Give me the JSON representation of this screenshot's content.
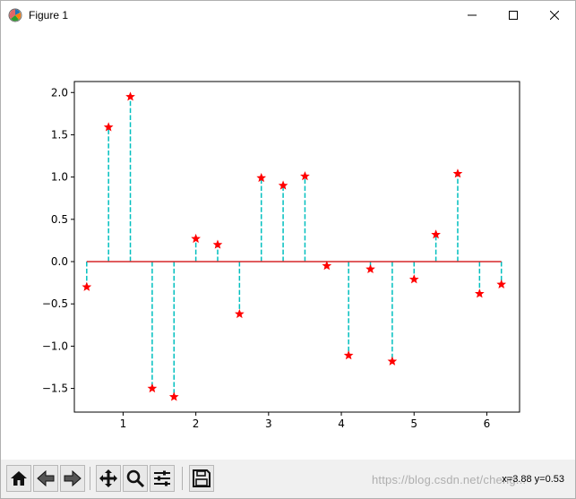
{
  "window": {
    "title": "Figure 1",
    "icons": {
      "app": "matplotlib-icon",
      "minimize": "minimize-icon",
      "maximize": "maximize-icon",
      "close": "close-icon"
    }
  },
  "toolbar": {
    "buttons": [
      {
        "name": "home-button",
        "icon": "home-icon"
      },
      {
        "name": "back-button",
        "icon": "arrow-left-icon"
      },
      {
        "name": "forward-button",
        "icon": "arrow-right-icon"
      },
      {
        "name": "pan-button",
        "icon": "move-icon"
      },
      {
        "name": "zoom-button",
        "icon": "magnifier-icon"
      },
      {
        "name": "configure-subplots-button",
        "icon": "sliders-icon"
      },
      {
        "name": "save-button",
        "icon": "floppy-disk-icon"
      }
    ],
    "watermark": "https://blog.csdn.net/cheng...",
    "coords": "x=3.88 y=0.53"
  },
  "chart_data": {
    "type": "stem",
    "x": [
      0.5,
      0.8,
      1.1,
      1.4,
      1.7,
      2.0,
      2.3,
      2.6,
      2.9,
      3.2,
      3.5,
      3.8,
      4.1,
      4.4,
      4.7,
      5.0,
      5.3,
      5.6,
      5.9,
      6.2
    ],
    "values": [
      -0.3,
      1.59,
      1.95,
      -1.5,
      -1.6,
      0.27,
      0.2,
      -0.62,
      0.99,
      0.9,
      1.01,
      -0.05,
      -1.11,
      -0.09,
      -1.18,
      -0.21,
      0.32,
      1.04,
      -0.38,
      -0.27
    ],
    "baseline": 0,
    "xlim": [
      0.33,
      6.45
    ],
    "ylim": [
      -1.78,
      2.13
    ],
    "xticks": [
      "1",
      "2",
      "3",
      "4",
      "5",
      "6"
    ],
    "xtick_values": [
      1,
      2,
      3,
      4,
      5,
      6
    ],
    "yticks": [
      "−1.5",
      "−1.0",
      "−0.5",
      "0.0",
      "0.5",
      "1.0",
      "1.5",
      "2.0"
    ],
    "ytick_values": [
      -1.5,
      -1.0,
      -0.5,
      0.0,
      0.5,
      1.0,
      1.5,
      2.0
    ],
    "stem_color": "#00bfbf",
    "marker_color": "#ff0000",
    "baseline_color": "#d62728",
    "marker": "star",
    "grid": false
  }
}
